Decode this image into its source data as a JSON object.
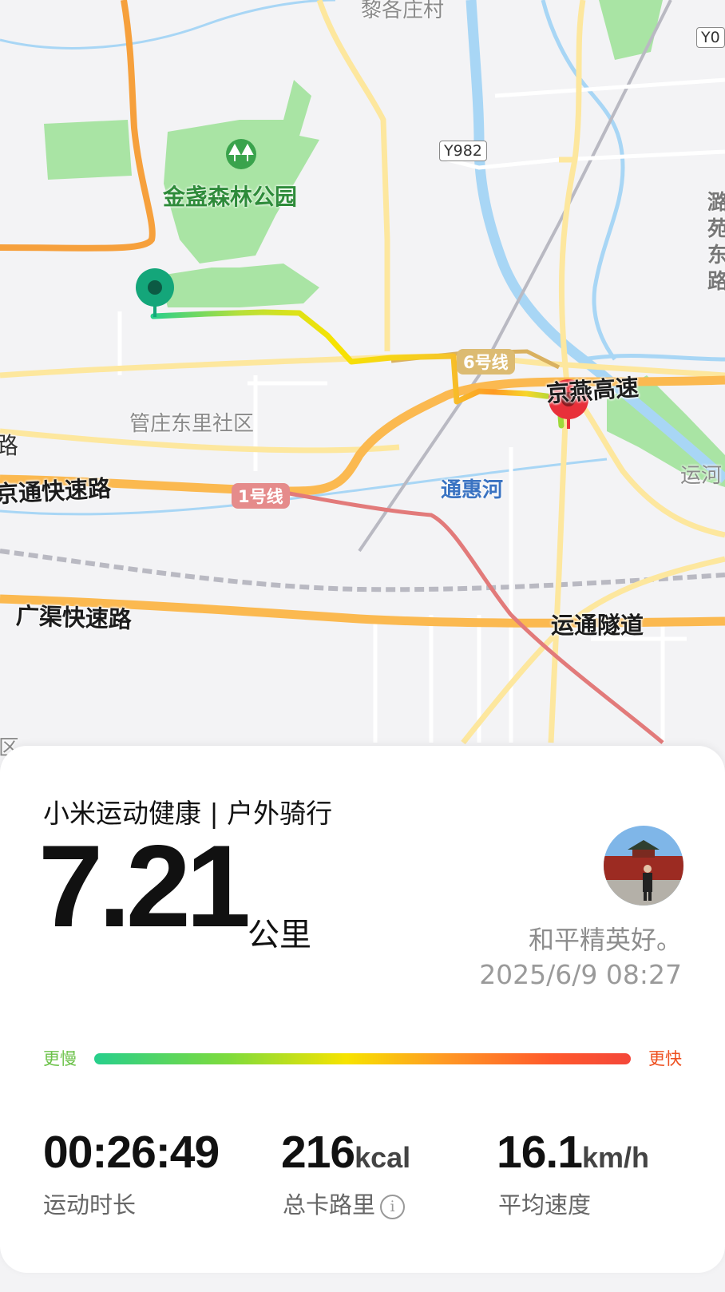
{
  "map": {
    "labels": {
      "village": "黎各庄村",
      "road_y982": "Y982",
      "road_y0": "Y0",
      "park": "金盏森林公园",
      "right_vertical": "潞苑东路",
      "community": "管庄东里社区",
      "left_edge_road": "路",
      "jingtong": "京通快速路",
      "line1": "1号线",
      "line6": "6号线",
      "jingyan": "京燕高速",
      "tonghui_river": "通惠河",
      "yunhe": "运河",
      "guangqu": "广渠快速路",
      "yuntong": "运通隧道",
      "left_bottom": "区"
    },
    "colors": {
      "park": "#a3e3a3",
      "river": "#a8d6f5",
      "expressway": "#fbb950",
      "arterial": "#fde79e",
      "metro_line1": "#e27a7a",
      "metro_line6": "#d9b160",
      "start_pin": "#14a67a",
      "end_pin": "#e8303a"
    }
  },
  "card": {
    "title": "小米运动健康 | 户外骑行",
    "distance": "7.21",
    "distance_unit": "公里",
    "user_name": "和平精英好。",
    "datetime": "2025/6/9 08:27",
    "speed_slow_label": "更慢",
    "speed_fast_label": "更快",
    "stats": [
      {
        "value": "00:26:49",
        "unit": "",
        "label": "运动时长"
      },
      {
        "value": "216",
        "unit": "kcal",
        "label": "总卡路里"
      },
      {
        "value": "16.1",
        "unit": "km/h",
        "label": "平均速度"
      }
    ],
    "info_icon": "info-circle-icon",
    "avatar_icon": "user-avatar"
  }
}
